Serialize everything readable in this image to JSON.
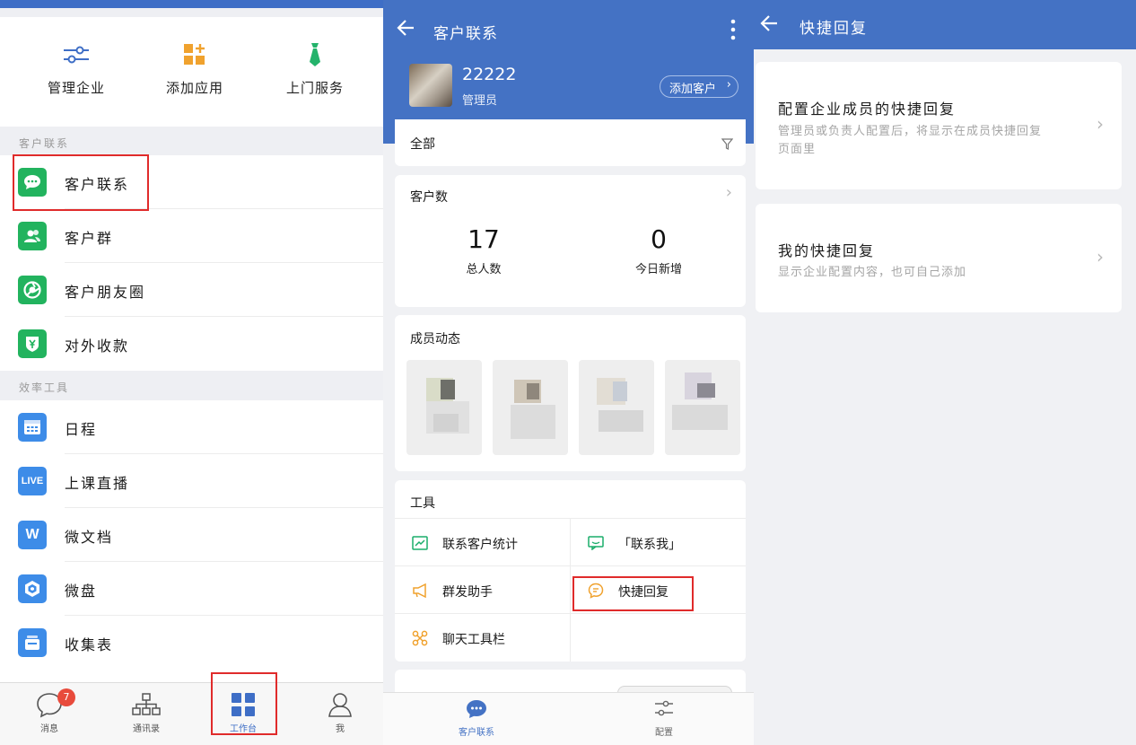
{
  "panel1": {
    "quick_actions": [
      {
        "label": "管理企业",
        "icon": "sliders-icon"
      },
      {
        "label": "添加应用",
        "icon": "add-app-grid-icon"
      },
      {
        "label": "上门服务",
        "icon": "tie-icon"
      }
    ],
    "section_customer": "客户联系",
    "customer_items": [
      {
        "label": "客户联系",
        "icon": "chat-bubble-icon"
      },
      {
        "label": "客户群",
        "icon": "group-icon"
      },
      {
        "label": "客户朋友圈",
        "icon": "moments-shutter-icon"
      },
      {
        "label": "对外收款",
        "icon": "yuan-shield-icon"
      }
    ],
    "section_tools": "效率工具",
    "tool_items": [
      {
        "label": "日程",
        "icon": "calendar-icon"
      },
      {
        "label": "上课直播",
        "icon": "live-icon",
        "glyph": "LIVE"
      },
      {
        "label": "微文档",
        "icon": "doc-w-icon",
        "glyph": "W"
      },
      {
        "label": "微盘",
        "icon": "drive-icon"
      },
      {
        "label": "收集表",
        "icon": "form-icon"
      }
    ],
    "tabbar": [
      {
        "label": "消息",
        "icon": "message-icon",
        "badge": "7"
      },
      {
        "label": "通讯录",
        "icon": "org-chart-icon"
      },
      {
        "label": "工作台",
        "icon": "workbench-grid-icon",
        "active": true
      },
      {
        "label": "我",
        "icon": "person-icon"
      }
    ],
    "accent": "#3e6ec6",
    "highlight_color": "#e02b2b"
  },
  "panel2": {
    "title": "客户联系",
    "profile": {
      "name": "22222",
      "role": "管理员",
      "add_button": "添加客户"
    },
    "filter_label": "全部",
    "stats": {
      "title": "客户数",
      "total_value": "17",
      "total_label": "总人数",
      "new_value": "0",
      "new_label": "今日新增"
    },
    "member_activity_title": "成员动态",
    "tools_title": "工具",
    "tools": [
      {
        "label": "联系客户统计",
        "icon": "line-chart-icon",
        "color": "#1aad6a"
      },
      {
        "label": "「联系我」",
        "icon": "chat-qr-icon",
        "color": "#1aad6a"
      },
      {
        "label": "群发助手",
        "icon": "megaphone-icon",
        "color": "#f0a22e"
      },
      {
        "label": "快捷回复",
        "icon": "quick-reply-icon",
        "color": "#f0a22e"
      },
      {
        "label": "聊天工具栏",
        "icon": "toolbar-icon",
        "color": "#f0a22e"
      }
    ],
    "bottom_tabs": [
      {
        "label": "客户联系",
        "icon": "chat-bubble-icon",
        "active": true
      },
      {
        "label": "配置",
        "icon": "sliders-icon"
      }
    ],
    "header_color": "#4472c4"
  },
  "panel3": {
    "title": "快捷回复",
    "cards": [
      {
        "title": "配置企业成员的快捷回复",
        "desc": "管理员或负责人配置后，将显示在成员快捷回复页面里"
      },
      {
        "title": "我的快捷回复",
        "desc": "显示企业配置内容，也可自己添加"
      }
    ]
  }
}
